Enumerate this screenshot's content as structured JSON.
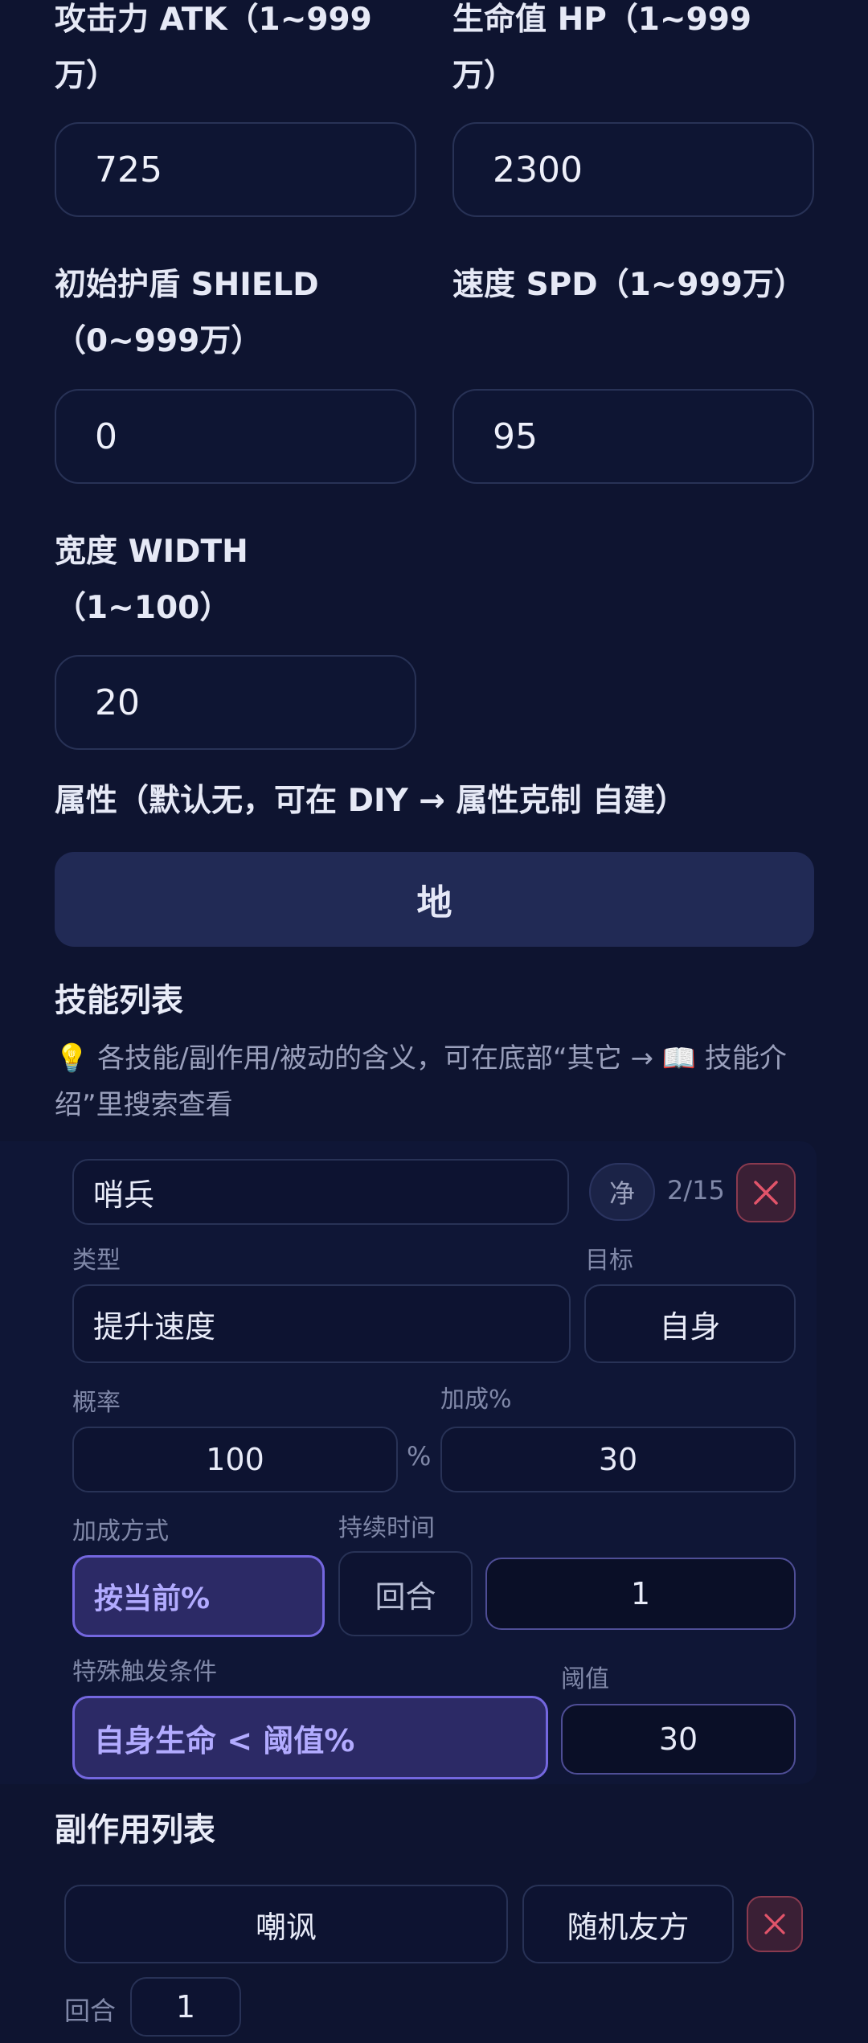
{
  "stats": {
    "atk": {
      "label": "攻击力 ATK（1~999万）",
      "value": "725"
    },
    "hp": {
      "label": "生命值 HP（1~999万）",
      "value": "2300"
    },
    "shield": {
      "label": "初始护盾 SHIELD（0~999万）",
      "value": "0"
    },
    "spd": {
      "label": "速度 SPD（1~999万）",
      "value": "95"
    },
    "width": {
      "label": "宽度 WIDTH（1~100）",
      "value": "20"
    }
  },
  "attribute": {
    "label": "属性（默认无，可在 DIY → 属性克制 自建）",
    "value": "地"
  },
  "skills": {
    "title": "技能列表",
    "hint": "💡 各技能/副作用/被动的含义，可在底部“其它 → 📖 技能介绍”里搜索查看",
    "item": {
      "name": "哨兵",
      "clean_label": "净",
      "count": "2/15",
      "type_label": "类型",
      "type_value": "提升速度",
      "target_label": "目标",
      "target_value": "自身",
      "chance_label": "概率",
      "chance_value": "100",
      "percent_sign": "%",
      "bonus_label": "加成%",
      "bonus_value": "30",
      "method_label": "加成方式",
      "method_value": "按当前%",
      "duration_label": "持续时间",
      "duration_unit": "回合",
      "duration_value": "1",
      "trigger_label": "特殊触发条件",
      "trigger_value": "自身生命 < 阈值%",
      "threshold_label": "阈值",
      "threshold_value": "30"
    }
  },
  "side_effects": {
    "title": "副作用列表",
    "item": {
      "name": "嘲讽",
      "target": "随机友方",
      "round_label": "回合",
      "round_value": "1"
    }
  },
  "colors": {
    "background": "#0e1430",
    "accent_purple": "#7467df",
    "danger": "#e2546a"
  }
}
